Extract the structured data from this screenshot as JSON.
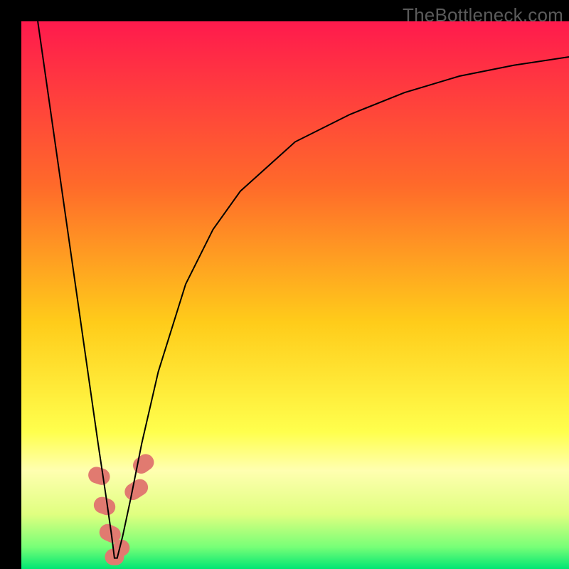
{
  "watermark": "TheBottleneck.com",
  "chart_data": {
    "type": "line",
    "title": "",
    "xlabel": "",
    "ylabel": "",
    "xlim": [
      0,
      100
    ],
    "ylim": [
      0,
      100
    ],
    "grid": false,
    "legend": false,
    "background_gradient": {
      "stops": [
        {
          "offset": 0.0,
          "color": "#ff1a4d"
        },
        {
          "offset": 0.3,
          "color": "#ff6a2a"
        },
        {
          "offset": 0.55,
          "color": "#ffcc1a"
        },
        {
          "offset": 0.75,
          "color": "#ffff4d"
        },
        {
          "offset": 0.82,
          "color": "#ffffb0"
        },
        {
          "offset": 0.9,
          "color": "#e0ff80"
        },
        {
          "offset": 0.96,
          "color": "#77ff77"
        },
        {
          "offset": 1.0,
          "color": "#00e673"
        }
      ]
    },
    "series": [
      {
        "name": "bottleneck-curve",
        "color": "#000000",
        "width": 2,
        "x": [
          3.0,
          5.0,
          8.0,
          10.0,
          12.0,
          14.0,
          15.5,
          16.5,
          17.0,
          17.5,
          18.5,
          20.0,
          22.0,
          25.0,
          30.0,
          35.0,
          40.0,
          50.0,
          60.0,
          70.0,
          80.0,
          90.0,
          100.0
        ],
        "y": [
          100.0,
          86.0,
          65.0,
          51.0,
          37.0,
          23.0,
          13.0,
          6.0,
          2.0,
          2.0,
          6.0,
          13.0,
          23.0,
          36.0,
          52.0,
          62.0,
          69.0,
          78.0,
          83.0,
          87.0,
          90.0,
          92.0,
          93.5
        ]
      }
    ],
    "markers": [
      {
        "name": "highlight-cluster",
        "color": "#e17a70",
        "shape": "rounded-rect",
        "points": [
          {
            "x": 14.2,
            "y": 17.0,
            "w": 3.0,
            "h": 4.0,
            "angle": -72
          },
          {
            "x": 15.2,
            "y": 11.5,
            "w": 3.0,
            "h": 4.0,
            "angle": -70
          },
          {
            "x": 16.2,
            "y": 6.5,
            "w": 3.0,
            "h": 4.0,
            "angle": -65
          },
          {
            "x": 17.0,
            "y": 2.2,
            "w": 3.5,
            "h": 3.0,
            "angle": 0
          },
          {
            "x": 18.2,
            "y": 3.8,
            "w": 3.0,
            "h": 3.2,
            "angle": 55
          },
          {
            "x": 21.0,
            "y": 14.5,
            "w": 3.0,
            "h": 4.5,
            "angle": 57
          },
          {
            "x": 22.3,
            "y": 19.2,
            "w": 3.0,
            "h": 4.0,
            "angle": 55
          }
        ]
      }
    ]
  }
}
